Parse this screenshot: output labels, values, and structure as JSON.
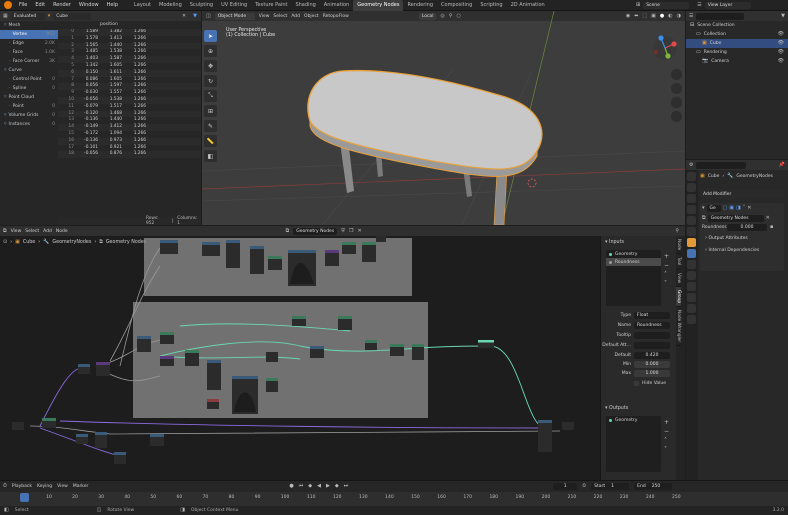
{
  "topbar": {
    "menus": [
      "File",
      "Edit",
      "Render",
      "Window",
      "Help"
    ],
    "workspaces": [
      "Layout",
      "Modeling",
      "Sculpting",
      "UV Editing",
      "Texture Paint",
      "Shading",
      "Animation",
      "Geometry Nodes",
      "Rendering",
      "Compositing",
      "Scripting",
      "2D Animation"
    ],
    "active_workspace": "Geometry Nodes",
    "scene": "Scene",
    "view_layer": "View Layer"
  },
  "spreadsheet": {
    "mode": "Evaluated",
    "object": "Cube",
    "column_header": "position",
    "tree": [
      {
        "label": "Mesh",
        "count": "",
        "indent": 0
      },
      {
        "label": "Vertex",
        "count": "952",
        "indent": 1,
        "active": true
      },
      {
        "label": "Edge",
        "count": "2.0K",
        "indent": 1
      },
      {
        "label": "Face",
        "count": "1.0K",
        "indent": 1
      },
      {
        "label": "Face Corner",
        "count": "3K",
        "indent": 1
      },
      {
        "label": "Curve",
        "count": "",
        "indent": 0
      },
      {
        "label": "Control Point",
        "count": "0",
        "indent": 1
      },
      {
        "label": "Spline",
        "count": "0",
        "indent": 1
      },
      {
        "label": "Point Cloud",
        "count": "",
        "indent": 0
      },
      {
        "label": "Point",
        "count": "0",
        "indent": 1
      },
      {
        "label": "Volume Grids",
        "count": "0",
        "indent": 0
      },
      {
        "label": "Instances",
        "count": "0",
        "indent": 0
      }
    ],
    "rows": [
      [
        "0",
        "1.589",
        "1.382",
        "1.266"
      ],
      [
        "1",
        "1.578",
        "1.413",
        "1.266"
      ],
      [
        "2",
        "1.565",
        "1.440",
        "1.266"
      ],
      [
        "3",
        "1.485",
        "1.538",
        "1.266"
      ],
      [
        "4",
        "1.403",
        "1.587",
        "1.266"
      ],
      [
        "5",
        "1.342",
        "1.605",
        "1.266"
      ],
      [
        "6",
        "0.150",
        "1.611",
        "1.266"
      ],
      [
        "7",
        "0.086",
        "1.605",
        "1.266"
      ],
      [
        "8",
        "0.056",
        "1.597",
        "1.266"
      ],
      [
        "9",
        "-0.030",
        "1.557",
        "1.266"
      ],
      [
        "10",
        "-0.056",
        "1.538",
        "1.266"
      ],
      [
        "11",
        "-0.079",
        "1.517",
        "1.266"
      ],
      [
        "12",
        "-0.120",
        "1.468",
        "1.266"
      ],
      [
        "13",
        "-0.136",
        "1.440",
        "1.266"
      ],
      [
        "14",
        "-0.149",
        "1.412",
        "1.266"
      ],
      [
        "15",
        "-0.172",
        "1.094",
        "1.266"
      ],
      [
        "16",
        "-0.136",
        "0.973",
        "1.266"
      ],
      [
        "17",
        "-0.101",
        "0.921",
        "1.266"
      ],
      [
        "18",
        "-0.056",
        "0.876",
        "1.266"
      ]
    ],
    "footer_rows": "Rows: 952",
    "footer_cols": "Columns: 1"
  },
  "viewport": {
    "mode": "Object Mode",
    "menus": [
      "View",
      "Select",
      "Add",
      "Object"
    ],
    "extra_menu": "RetopoFlow",
    "transform": "Local",
    "info_line1": "User Perspective",
    "info_line2": "(1) Collection | Cube"
  },
  "outliner": {
    "items": [
      {
        "label": "Scene Collection",
        "indent": 0
      },
      {
        "label": "Collection",
        "indent": 1
      },
      {
        "label": "Cube",
        "indent": 2,
        "active": true
      },
      {
        "label": "Rendering",
        "indent": 1
      },
      {
        "label": "Camera",
        "indent": 2
      }
    ]
  },
  "properties": {
    "object": "Cube",
    "modifier_group": "GeometryNodes",
    "add_modifier": "Add Modifier",
    "modifier_name": "Ge",
    "node_group": "Geometry Nodes",
    "roundness_label": "Roundness",
    "roundness_value": "0.000",
    "output_attributes": "Output Attributes",
    "internal_dependencies": "Internal Dependencies"
  },
  "node_editor": {
    "menus": [
      "View",
      "Select",
      "Add",
      "Node"
    ],
    "group_name": "Geometry Nodes",
    "breadcrumb": [
      "Cube",
      "GeometryNodes",
      "Geometry Nodes"
    ],
    "inputs_title": "Inputs",
    "inputs": [
      "Geometry",
      "Roundness"
    ],
    "type_label": "Type",
    "type_value": "Float",
    "name_label": "Name",
    "name_value": "Roundness",
    "tooltip_label": "Tooltip",
    "default_attr_label": "Default Att...",
    "default_label": "Default",
    "default_value": "0.420",
    "min_label": "Min",
    "min_value": "0.000",
    "max_label": "Max",
    "max_value": "1.000",
    "hide_value": "Hide Value",
    "outputs_title": "Outputs",
    "outputs": [
      "Geometry"
    ],
    "tabs": [
      "Node",
      "Tool",
      "View",
      "Group",
      "Node Wrangler"
    ]
  },
  "timeline": {
    "menus": [
      "Playback",
      "Keying",
      "View",
      "Marker"
    ],
    "current_frame": "1",
    "start_label": "Start",
    "start_value": "1",
    "end_label": "End",
    "end_value": "250",
    "ticks": [
      "1",
      "10",
      "20",
      "30",
      "40",
      "50",
      "60",
      "70",
      "80",
      "90",
      "100",
      "110",
      "120",
      "130",
      "140",
      "150",
      "160",
      "170",
      "180",
      "190",
      "200",
      "210",
      "220",
      "230",
      "240",
      "250"
    ]
  },
  "statusbar": {
    "select": "Select",
    "rotate": "Rotate View",
    "context": "Object Context Menu",
    "version": "3.2.0"
  },
  "colors": {
    "accent": "#4772b3",
    "selection_outline": "#e8a13a",
    "node_wire": "#6bd6b3",
    "node_wire_purple": "#8a6be0"
  }
}
